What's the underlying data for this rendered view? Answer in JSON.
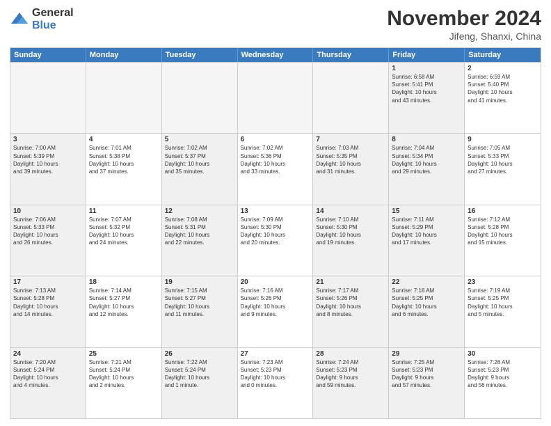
{
  "logo": {
    "general": "General",
    "blue": "Blue"
  },
  "header": {
    "month": "November 2024",
    "location": "Jifeng, Shanxi, China"
  },
  "weekdays": [
    "Sunday",
    "Monday",
    "Tuesday",
    "Wednesday",
    "Thursday",
    "Friday",
    "Saturday"
  ],
  "rows": [
    [
      {
        "day": "",
        "info": "",
        "empty": true
      },
      {
        "day": "",
        "info": "",
        "empty": true
      },
      {
        "day": "",
        "info": "",
        "empty": true
      },
      {
        "day": "",
        "info": "",
        "empty": true
      },
      {
        "day": "",
        "info": "",
        "empty": true
      },
      {
        "day": "1",
        "info": "Sunrise: 6:58 AM\nSunset: 5:41 PM\nDaylight: 10 hours\nand 43 minutes.",
        "shaded": true
      },
      {
        "day": "2",
        "info": "Sunrise: 6:59 AM\nSunset: 5:40 PM\nDaylight: 10 hours\nand 41 minutes.",
        "shaded": false
      }
    ],
    [
      {
        "day": "3",
        "info": "Sunrise: 7:00 AM\nSunset: 5:39 PM\nDaylight: 10 hours\nand 39 minutes.",
        "shaded": true
      },
      {
        "day": "4",
        "info": "Sunrise: 7:01 AM\nSunset: 5:38 PM\nDaylight: 10 hours\nand 37 minutes.",
        "shaded": false
      },
      {
        "day": "5",
        "info": "Sunrise: 7:02 AM\nSunset: 5:37 PM\nDaylight: 10 hours\nand 35 minutes.",
        "shaded": true
      },
      {
        "day": "6",
        "info": "Sunrise: 7:02 AM\nSunset: 5:36 PM\nDaylight: 10 hours\nand 33 minutes.",
        "shaded": false
      },
      {
        "day": "7",
        "info": "Sunrise: 7:03 AM\nSunset: 5:35 PM\nDaylight: 10 hours\nand 31 minutes.",
        "shaded": true
      },
      {
        "day": "8",
        "info": "Sunrise: 7:04 AM\nSunset: 5:34 PM\nDaylight: 10 hours\nand 29 minutes.",
        "shaded": true
      },
      {
        "day": "9",
        "info": "Sunrise: 7:05 AM\nSunset: 5:33 PM\nDaylight: 10 hours\nand 27 minutes.",
        "shaded": false
      }
    ],
    [
      {
        "day": "10",
        "info": "Sunrise: 7:06 AM\nSunset: 5:33 PM\nDaylight: 10 hours\nand 26 minutes.",
        "shaded": true
      },
      {
        "day": "11",
        "info": "Sunrise: 7:07 AM\nSunset: 5:32 PM\nDaylight: 10 hours\nand 24 minutes.",
        "shaded": false
      },
      {
        "day": "12",
        "info": "Sunrise: 7:08 AM\nSunset: 5:31 PM\nDaylight: 10 hours\nand 22 minutes.",
        "shaded": true
      },
      {
        "day": "13",
        "info": "Sunrise: 7:09 AM\nSunset: 5:30 PM\nDaylight: 10 hours\nand 20 minutes.",
        "shaded": false
      },
      {
        "day": "14",
        "info": "Sunrise: 7:10 AM\nSunset: 5:30 PM\nDaylight: 10 hours\nand 19 minutes.",
        "shaded": true
      },
      {
        "day": "15",
        "info": "Sunrise: 7:11 AM\nSunset: 5:29 PM\nDaylight: 10 hours\nand 17 minutes.",
        "shaded": true
      },
      {
        "day": "16",
        "info": "Sunrise: 7:12 AM\nSunset: 5:28 PM\nDaylight: 10 hours\nand 15 minutes.",
        "shaded": false
      }
    ],
    [
      {
        "day": "17",
        "info": "Sunrise: 7:13 AM\nSunset: 5:28 PM\nDaylight: 10 hours\nand 14 minutes.",
        "shaded": true
      },
      {
        "day": "18",
        "info": "Sunrise: 7:14 AM\nSunset: 5:27 PM\nDaylight: 10 hours\nand 12 minutes.",
        "shaded": false
      },
      {
        "day": "19",
        "info": "Sunrise: 7:15 AM\nSunset: 5:27 PM\nDaylight: 10 hours\nand 11 minutes.",
        "shaded": true
      },
      {
        "day": "20",
        "info": "Sunrise: 7:16 AM\nSunset: 5:26 PM\nDaylight: 10 hours\nand 9 minutes.",
        "shaded": false
      },
      {
        "day": "21",
        "info": "Sunrise: 7:17 AM\nSunset: 5:26 PM\nDaylight: 10 hours\nand 8 minutes.",
        "shaded": true
      },
      {
        "day": "22",
        "info": "Sunrise: 7:18 AM\nSunset: 5:25 PM\nDaylight: 10 hours\nand 6 minutes.",
        "shaded": true
      },
      {
        "day": "23",
        "info": "Sunrise: 7:19 AM\nSunset: 5:25 PM\nDaylight: 10 hours\nand 5 minutes.",
        "shaded": false
      }
    ],
    [
      {
        "day": "24",
        "info": "Sunrise: 7:20 AM\nSunset: 5:24 PM\nDaylight: 10 hours\nand 4 minutes.",
        "shaded": true
      },
      {
        "day": "25",
        "info": "Sunrise: 7:21 AM\nSunset: 5:24 PM\nDaylight: 10 hours\nand 2 minutes.",
        "shaded": false
      },
      {
        "day": "26",
        "info": "Sunrise: 7:22 AM\nSunset: 5:24 PM\nDaylight: 10 hours\nand 1 minute.",
        "shaded": true
      },
      {
        "day": "27",
        "info": "Sunrise: 7:23 AM\nSunset: 5:23 PM\nDaylight: 10 hours\nand 0 minutes.",
        "shaded": false
      },
      {
        "day": "28",
        "info": "Sunrise: 7:24 AM\nSunset: 5:23 PM\nDaylight: 9 hours\nand 59 minutes.",
        "shaded": true
      },
      {
        "day": "29",
        "info": "Sunrise: 7:25 AM\nSunset: 5:23 PM\nDaylight: 9 hours\nand 57 minutes.",
        "shaded": true
      },
      {
        "day": "30",
        "info": "Sunrise: 7:26 AM\nSunset: 5:23 PM\nDaylight: 9 hours\nand 56 minutes.",
        "shaded": false
      }
    ]
  ]
}
